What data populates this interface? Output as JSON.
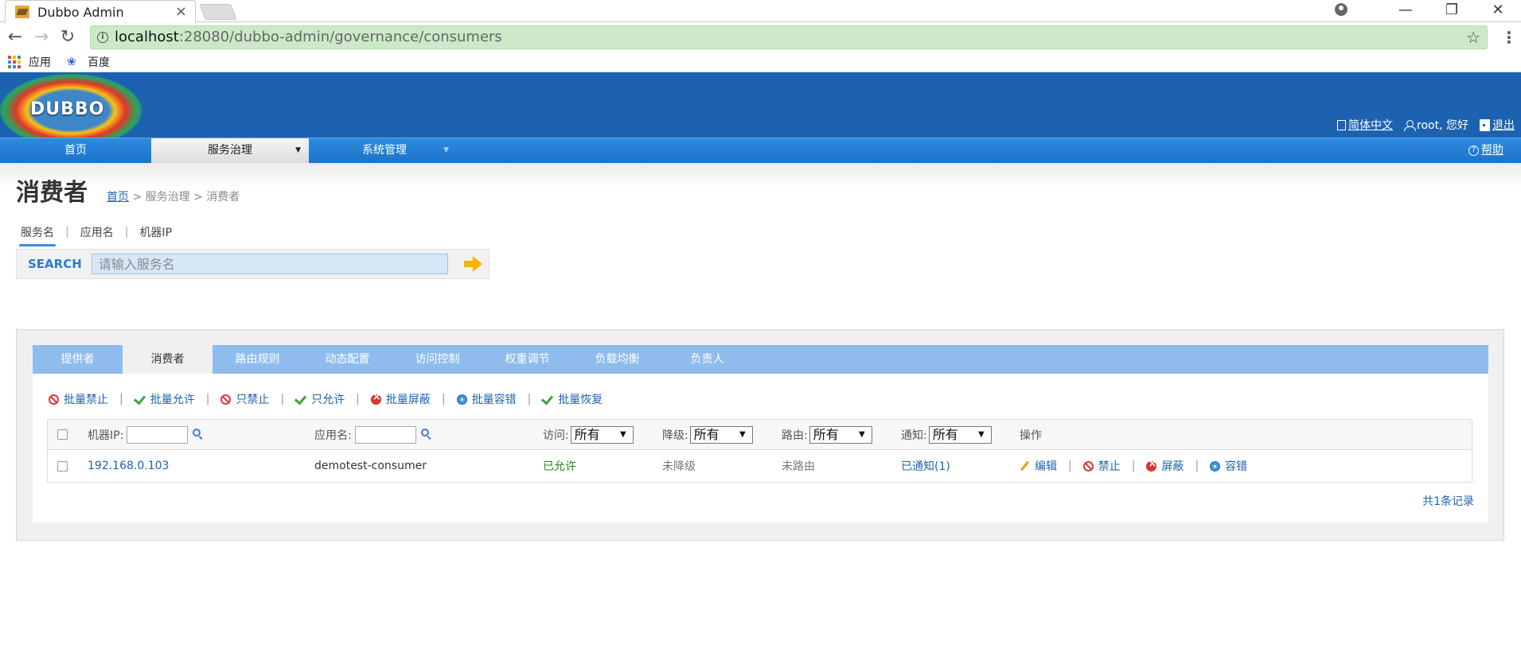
{
  "browser": {
    "tab_title": "Dubbo Admin",
    "tab_close": "×",
    "url_host": "localhost",
    "url_rest": ":28080/dubbo-admin/governance/consumers",
    "back": "←",
    "forward": "→",
    "reload": "↻",
    "star": "☆",
    "menu": "⋮",
    "minimize": "—",
    "restore": "❐",
    "close": "✕",
    "bookmarks": [
      "应用",
      "百度"
    ]
  },
  "header": {
    "logo_text": "DUBBO",
    "language": "简体中文",
    "greeting": "root, 您好",
    "logout": "退出"
  },
  "mainnav": {
    "items": [
      "首页",
      "服务治理",
      "系统管理"
    ],
    "help": "帮助",
    "help_icon": "?"
  },
  "page": {
    "title": "消费者",
    "breadcrumb_home": "首页",
    "breadcrumb_rest": " > 服务治理 > 消费者"
  },
  "search": {
    "tabs": [
      "服务名",
      "应用名",
      "机器IP"
    ],
    "label": "SEARCH",
    "placeholder": "请输入服务名"
  },
  "gov_tabs": [
    "提供者",
    "消费者",
    "路由规则",
    "动态配置",
    "访问控制",
    "权重调节",
    "负载均衡",
    "负责人"
  ],
  "batch_actions": [
    "批量禁止",
    "批量允许",
    "只禁止",
    "只允许",
    "批量屏蔽",
    "批量容错",
    "批量恢复"
  ],
  "table": {
    "headers": {
      "ip": "机器IP:",
      "app": "应用名:",
      "access": "访问:",
      "degrade": "降级:",
      "route": "路由:",
      "notify": "通知:",
      "ops": "操作"
    },
    "select_value": "所有",
    "rows": [
      {
        "ip": "192.168.0.103",
        "app": "demotest-consumer",
        "access": "已允许",
        "degrade": "未降级",
        "route": "未路由",
        "notify": "已通知(1)",
        "ops": [
          "编辑",
          "禁止",
          "屏蔽",
          "容错"
        ]
      }
    ]
  },
  "total": "共1条记录"
}
